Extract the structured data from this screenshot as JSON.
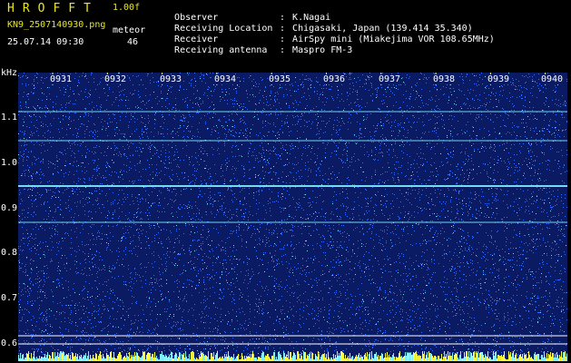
{
  "header": {
    "app_title": "HROFFT",
    "version": "1.00f",
    "filename": "KN9_2507140930.png",
    "app_name": "meteor",
    "datetime": "25.07.14 09:30",
    "count": "46"
  },
  "meta": [
    {
      "key": "Observer",
      "value": "K.Nagai"
    },
    {
      "key": "Receiving Location",
      "value": "Chigasaki, Japan (139.414 35.340)"
    },
    {
      "key": "Receiver",
      "value": "AirSpy mini (Miakejima VOR 108.65MHz)"
    },
    {
      "key": "Receiving antenna",
      "value": "Maspro FM-3"
    }
  ],
  "spectrogram": {
    "y_unit": "kHz",
    "y_ticks": [
      "1.1",
      "1.0",
      "0.9",
      "0.8",
      "0.7",
      "0.6"
    ],
    "x_ticks": [
      "0931",
      "0932",
      "0933",
      "0934",
      "0935",
      "0936",
      "0937",
      "0938",
      "0939",
      "0940"
    ],
    "colors": {
      "background": "#0a1a63",
      "noise": "#2f6cff",
      "noise_bright": "#7fd8ff",
      "signal": "#7ff0ff",
      "baseline": "#ffff40"
    }
  }
}
